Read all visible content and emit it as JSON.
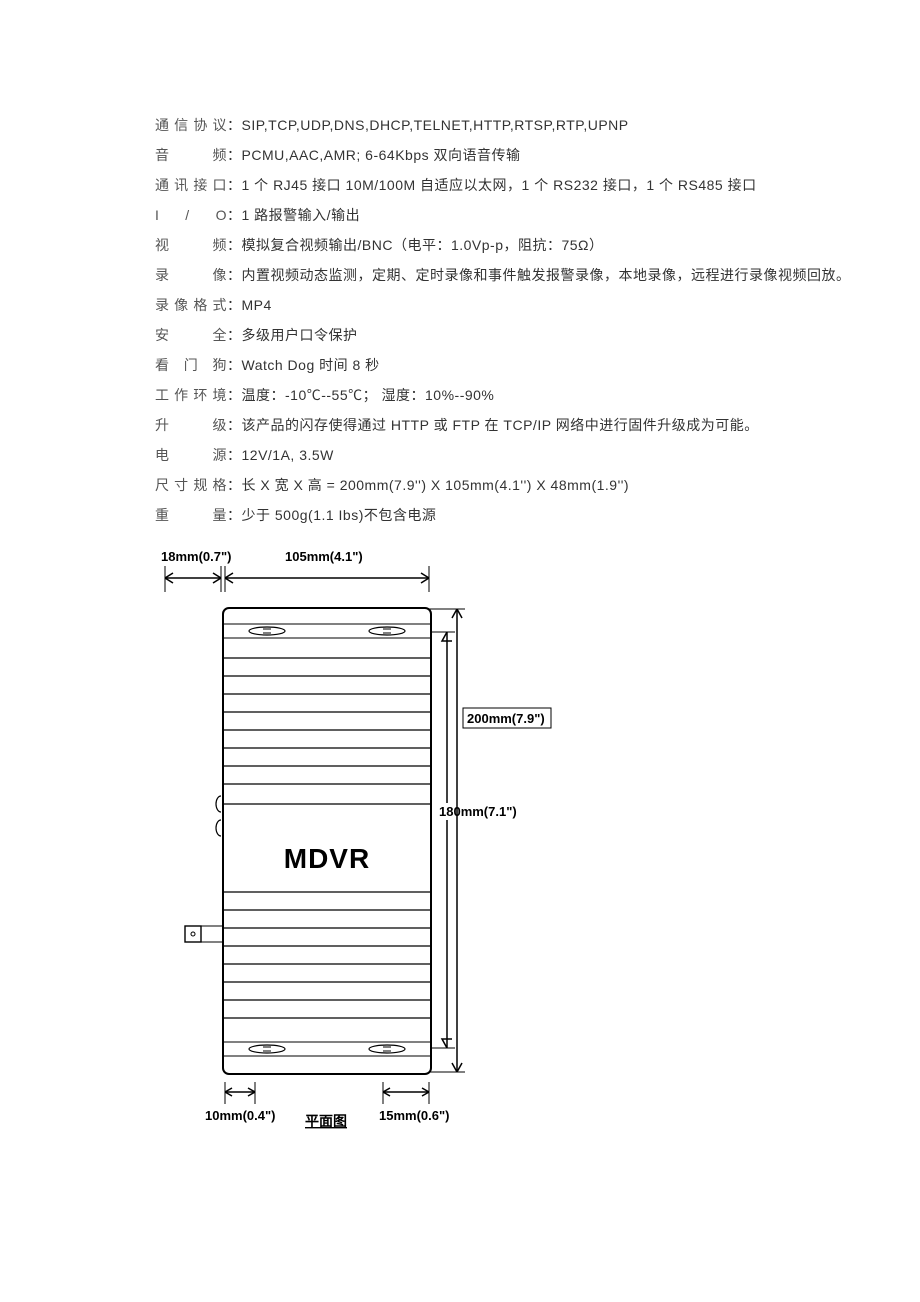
{
  "specs": [
    {
      "label": "通信协议",
      "value": "SIP,TCP,UDP,DNS,DHCP,TELNET,HTTP,RTSP,RTP,UPNP"
    },
    {
      "label": "音　　频",
      "value": "PCMU,AAC,AMR; 6-64Kbps  双向语音传输"
    },
    {
      "label": "通讯接口",
      "value": "1 个 RJ45 接口  10M/100M 自适应以太网，1 个 RS232 接口，1 个 RS485 接口"
    },
    {
      "label": "I / O",
      "value": "1 路报警输入/输出"
    },
    {
      "label": "视　　频",
      "value": "模拟复合视频输出/BNC（电平：1.0Vp-p，阻抗：75Ω）"
    },
    {
      "label": "录　　像",
      "value": "内置视频动态监测，定期、定时录像和事件触发报警录像，本地录像，远程进行录像视频回放。"
    },
    {
      "label": "录像格式",
      "value": "MP4"
    },
    {
      "label": "安　　全",
      "value": "多级用户口令保护"
    },
    {
      "label": "看 门 狗",
      "value": "Watch Dog 时间 8 秒"
    },
    {
      "label": "工作环境",
      "value": "温度：-10℃--55℃； 湿度：10%--90%"
    },
    {
      "label": "升　　级",
      "value": "该产品的闪存使得通过 HTTP 或 FTP 在 TCP/IP 网络中进行固件升级成为可能。"
    },
    {
      "label": "电　　源",
      "value": "12V/1A, 3.5W"
    },
    {
      "label": "尺寸规格",
      "value": "长 X 宽 X 高  =  200mm(7.9'') X 105mm(4.1'') X 48mm(1.9'')"
    },
    {
      "label": "重　　量",
      "value": "少于 500g(1.1 Ibs)不包含电源"
    }
  ],
  "diagram": {
    "dim_18mm": "18mm(0.7\")",
    "dim_105mm": "105mm(4.1\")",
    "dim_200mm": "200mm(7.9\")",
    "dim_180mm": "180mm(7.1\")",
    "dim_10mm": "10mm(0.4\")",
    "dim_15mm": "15mm(0.6\")",
    "device_label": "MDVR",
    "caption": "平面图"
  }
}
